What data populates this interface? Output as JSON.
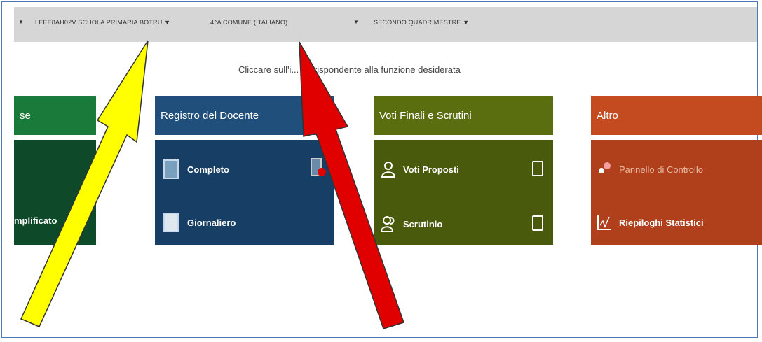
{
  "topbar": {
    "school": "LEEE8AH02V SCUOLA PRIMARIA BOTRU ▼",
    "class": "4^A COMUNE (ITALIANO)",
    "class_caret": "▼",
    "period": "SECONDO QUADRIMESTRE ▼",
    "lead_caret": "▼"
  },
  "instruction": "Cliccare sull'i... corrispondente alla funzione desiderata",
  "tiles": [
    {
      "title": "se",
      "color_head": "#1a7a3a",
      "color_body": "#0e4a2a",
      "items": [
        "mplificato"
      ]
    },
    {
      "title": "Registro del Docente",
      "color_head": "#1f4f7a",
      "color_body": "#173f66",
      "items": [
        "Completo",
        "Giornaliero"
      ]
    },
    {
      "title": "Voti Finali e Scrutini",
      "color_head": "#5a6e10",
      "color_body": "#4a5a0c",
      "items": [
        "Voti Proposti",
        "Scrutinio"
      ]
    },
    {
      "title": "Altro",
      "color_head": "#c44a20",
      "color_body": "#b0401c",
      "items": [
        "Pannello di Controllo",
        "Riepiloghi Statistici"
      ]
    }
  ],
  "arrows": {
    "yellow": "#ffff00",
    "red": "#e00000"
  }
}
